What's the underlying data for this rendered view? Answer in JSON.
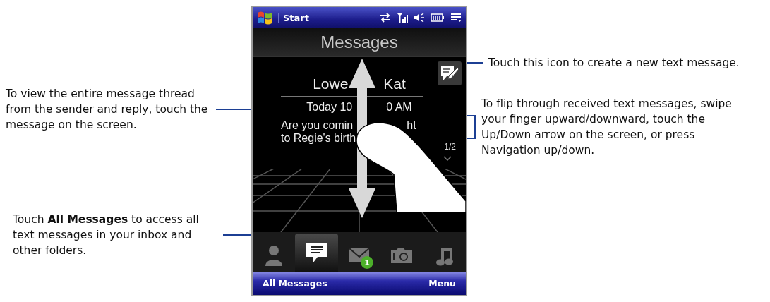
{
  "status_bar": {
    "start": "Start"
  },
  "title": "Messages",
  "message": {
    "sender": [
      "Lowe",
      "Kat"
    ],
    "time": [
      "Today 10",
      "0 AM"
    ],
    "lines": [
      [
        "Are you comin",
        "ht"
      ],
      [
        "to Regie's birth"
      ]
    ],
    "counter": "1/2"
  },
  "tabs": [
    {
      "kind": "contacts",
      "selected": false
    },
    {
      "kind": "messages",
      "selected": true
    },
    {
      "kind": "mail",
      "selected": false,
      "badge": "1"
    },
    {
      "kind": "camera",
      "selected": false
    },
    {
      "kind": "music",
      "selected": false
    }
  ],
  "softkeys": {
    "left": "All Messages",
    "right": "Menu"
  },
  "callouts": {
    "left": [
      "To view the entire message thread from the sender and reply, touch the message on the screen.",
      "Touch **All Messages** to access all text messages in your inbox and other folders."
    ],
    "right": [
      "Touch this icon to create a new text message.",
      "To flip through received text messages, swipe your finger upward/downward, touch the Up/Down arrow on the screen, or press Navigation up/down."
    ]
  }
}
